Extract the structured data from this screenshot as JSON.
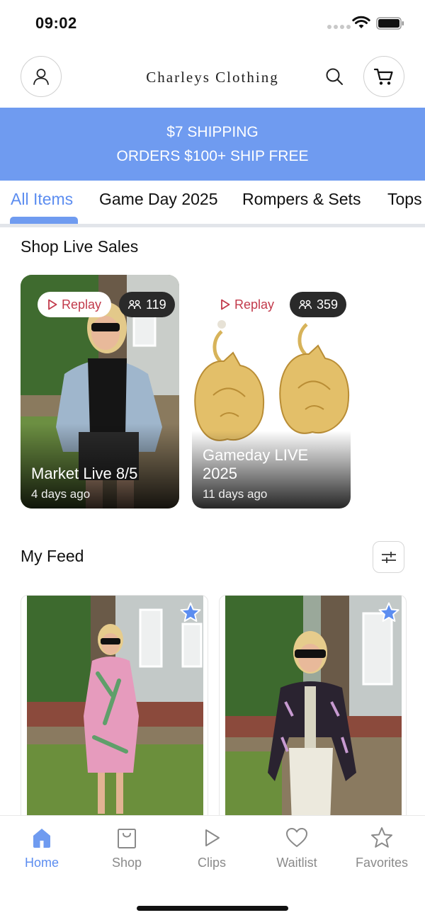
{
  "status_bar": {
    "time": "09:02"
  },
  "header": {
    "brand": "Charleys Clothing"
  },
  "banner": {
    "line1": "$7 SHIPPING",
    "line2": "ORDERS $100+ SHIP FREE"
  },
  "tabs": [
    {
      "label": "All Items",
      "active": true
    },
    {
      "label": "Game Day 2025",
      "active": false
    },
    {
      "label": "Rompers & Sets",
      "active": false
    },
    {
      "label": "Tops",
      "active": false
    }
  ],
  "live_sales": {
    "title": "Shop Live Sales",
    "cards": [
      {
        "replay_label": "Replay",
        "viewers": "119",
        "title": "Market Live 8/5",
        "subtitle": "4 days ago"
      },
      {
        "replay_label": "Replay",
        "viewers": "359",
        "title": "Gameday LIVE 2025",
        "subtitle": "11 days ago"
      }
    ]
  },
  "feed": {
    "title": "My Feed"
  },
  "colors": {
    "accent": "#6f9bf0",
    "accent_text": "#5c8df0",
    "replay_red": "#c23a4b",
    "star_blue": "#5c8df0"
  },
  "bottom_nav": [
    {
      "label": "Home",
      "icon": "home-icon",
      "active": true
    },
    {
      "label": "Shop",
      "icon": "shop-bag-icon",
      "active": false
    },
    {
      "label": "Clips",
      "icon": "play-icon",
      "active": false
    },
    {
      "label": "Waitlist",
      "icon": "heart-icon",
      "active": false
    },
    {
      "label": "Favorites",
      "icon": "star-icon",
      "active": false
    }
  ]
}
